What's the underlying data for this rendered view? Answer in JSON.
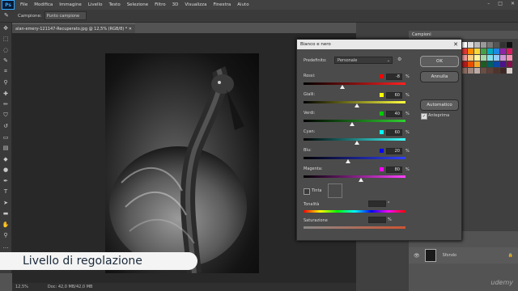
{
  "menubar": {
    "logo": "Ps",
    "items": [
      "File",
      "Modifica",
      "Immagine",
      "Livello",
      "Testo",
      "Selezione",
      "Filtro",
      "3D",
      "Visualizza",
      "Finestra",
      "Aiuto"
    ]
  },
  "options_bar": {
    "label": "Campione:",
    "value": "Punto campione"
  },
  "document": {
    "tab_title": "alan-emery-121147-Recuperato.jpg @ 12,5% (RGB/8) *",
    "status_zoom": "12,5%",
    "status_doc": "Doc: 42,0 MB/42,0 MB"
  },
  "dialog": {
    "title": "Bianco e nero",
    "preset_label": "Predefinito:",
    "preset_value": "Personale",
    "sliders": [
      {
        "label": "Rossi:",
        "value": "-8",
        "color": "#ff0000",
        "position_pct": -8
      },
      {
        "label": "Gialli:",
        "value": "60",
        "color": "#ffff00",
        "position_pct": 60
      },
      {
        "label": "Verdi:",
        "value": "40",
        "color": "#00cc00",
        "position_pct": 40
      },
      {
        "label": "Cyan:",
        "value": "60",
        "color": "#00ffff",
        "position_pct": 60
      },
      {
        "label": "Blu:",
        "value": "20",
        "color": "#0000ff",
        "position_pct": 20
      },
      {
        "label": "Magenta:",
        "value": "80",
        "color": "#ff00ff",
        "position_pct": 80
      }
    ],
    "percent": "%",
    "tint_label": "Tinta",
    "hue_label": "Tonalità",
    "hue_unit": "°",
    "saturation_label": "Saturazione",
    "saturation_unit": "%",
    "ok_label": "OK",
    "cancel_label": "Annulla",
    "auto_label": "Automatico",
    "preview_label": "Anteprima",
    "preview_checked": true
  },
  "right_panel": {
    "swatches_tab": "Campioni",
    "layer_name": "Sfondo"
  },
  "overlay": {
    "lower_third": "Livello di regolazione",
    "watermark": "udemy"
  }
}
